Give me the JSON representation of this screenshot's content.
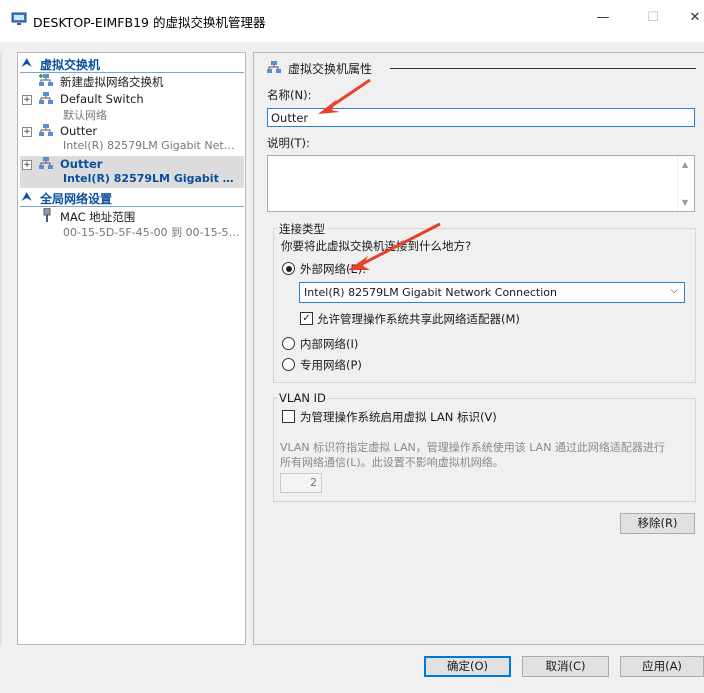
{
  "window": {
    "title": "DESKTOP-EIMFB19 的虚拟交换机管理器",
    "minimize": "—",
    "maximize": "☐",
    "close": "✕"
  },
  "left": {
    "section1": "虚拟交换机",
    "new_switch": "新建虚拟网络交换机",
    "items": [
      {
        "name": "Default Switch",
        "sub": "默认网络"
      },
      {
        "name": "Outter",
        "sub": "Intel(R) 82579LM Gigabit Network ..."
      },
      {
        "name": "Outter",
        "sub": "Intel(R) 82579LM Gigabit Net..."
      }
    ],
    "section2": "全局网络设置",
    "mac_label": "MAC 地址范围",
    "mac_value": "00-15-5D-5F-45-00 到 00-15-5D-5..."
  },
  "right": {
    "header": "虚拟交换机属性",
    "name_label": "名称(N):",
    "name_value": "Outter",
    "desc_label": "说明(T):",
    "conn_type_label": "连接类型",
    "conn_question": "你要将此虚拟交换机连接到什么地方?",
    "external_label": "外部网络(E):",
    "adapter_value": "Intel(R) 82579LM Gigabit Network Connection",
    "allow_share_label": "允许管理操作系统共享此网络适配器(M)",
    "internal_label": "内部网络(I)",
    "private_label": "专用网络(P)",
    "vlan_title": "VLAN ID",
    "vlan_check_label": "为管理操作系统启用虚拟 LAN 标识(V)",
    "vlan_desc_line1": "VLAN 标识符指定虚拟 LAN，管理操作系统使用该 LAN 通过此网络适配器进行",
    "vlan_desc_line2": "所有网络通信(L)。此设置不影响虚拟机网络。",
    "vlan_value": "2",
    "remove_button": "移除(R)"
  },
  "footer": {
    "ok": "确定(O)",
    "cancel": "取消(C)",
    "apply": "应用(A)"
  },
  "colors": {
    "accent": "#0078d7",
    "section_text": "#0b4f9e",
    "annotation_arrow": "#e8402a"
  }
}
